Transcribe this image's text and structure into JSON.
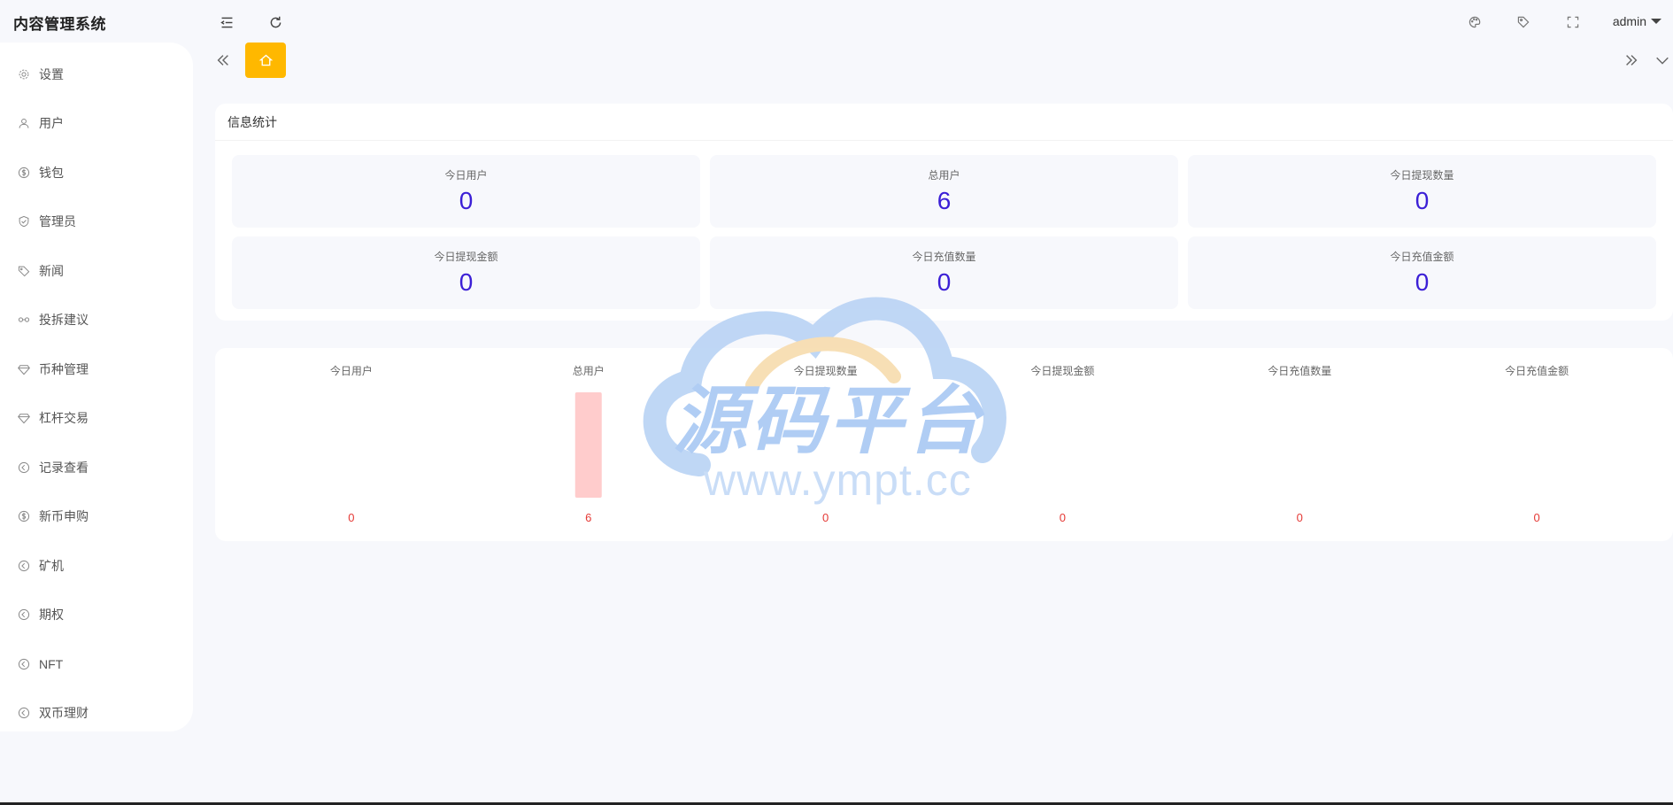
{
  "app": {
    "title": "内容管理系统"
  },
  "header": {
    "user": "admin"
  },
  "sidebar": {
    "items": [
      {
        "label": "设置",
        "icon": "gear-icon"
      },
      {
        "label": "用户",
        "icon": "user-icon"
      },
      {
        "label": "钱包",
        "icon": "dollar-icon"
      },
      {
        "label": "管理员",
        "icon": "shield-icon"
      },
      {
        "label": "新闻",
        "icon": "tag-icon"
      },
      {
        "label": "投拆建议",
        "icon": "link-icon"
      },
      {
        "label": "币种管理",
        "icon": "diamond-icon"
      },
      {
        "label": "杠杆交易",
        "icon": "diamond-icon"
      },
      {
        "label": "记录查看",
        "icon": "circle-arrow-icon"
      },
      {
        "label": "新币申购",
        "icon": "dollar-icon"
      },
      {
        "label": "矿机",
        "icon": "circle-arrow-icon"
      },
      {
        "label": "期权",
        "icon": "circle-arrow-icon"
      },
      {
        "label": "NFT",
        "icon": "circle-arrow-icon"
      },
      {
        "label": "双币理财",
        "icon": "circle-arrow-icon"
      }
    ]
  },
  "stats": {
    "title": "信息统计",
    "items": [
      {
        "label": "今日用户",
        "value": "0"
      },
      {
        "label": "总用户",
        "value": "6"
      },
      {
        "label": "今日提现数量",
        "value": "0"
      },
      {
        "label": "今日提现金额",
        "value": "0"
      },
      {
        "label": "今日充值数量",
        "value": "0"
      },
      {
        "label": "今日充值金额",
        "value": "0"
      }
    ]
  },
  "chart_data": {
    "type": "bar",
    "categories": [
      "今日用户",
      "总用户",
      "今日提现数量",
      "今日提现金额",
      "今日充值数量",
      "今日充值金额"
    ],
    "values": [
      0,
      6,
      0,
      0,
      0,
      0
    ],
    "data_labels": [
      "0",
      "6",
      "0",
      "0",
      "0",
      "0"
    ],
    "bar_color": "#ffcccc",
    "label_color": "#e53935",
    "grid": false,
    "legend": "none",
    "ylim": [
      0,
      6
    ]
  },
  "watermark": {
    "main": "源码平台",
    "sub": "www.ympt.cc"
  },
  "colors": {
    "accent": "#ffb800",
    "value": "#3b1fd6"
  }
}
